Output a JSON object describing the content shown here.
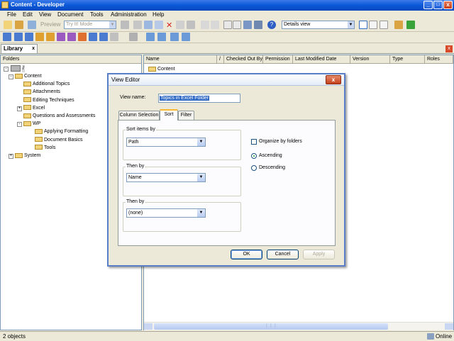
{
  "window": {
    "title": "Content - Developer",
    "min_glyph": "_",
    "max_glyph": "□",
    "close_glyph": "x"
  },
  "menu": [
    "File",
    "Edit",
    "View",
    "Document",
    "Tools",
    "Administration",
    "Help"
  ],
  "toolbar": {
    "preview_label": "Preview",
    "mode_combo": "Try It! Mode",
    "view_combo": "Details view"
  },
  "library_tab": {
    "label": "Library",
    "close_glyph": "x"
  },
  "folders": {
    "header": "Folders",
    "root": "/",
    "items": [
      {
        "label": "Content",
        "level": 1,
        "expander": "-"
      },
      {
        "label": "Additional Topics",
        "level": 2,
        "expander": ""
      },
      {
        "label": "Attachments",
        "level": 2,
        "expander": ""
      },
      {
        "label": "Editing Techniques",
        "level": 2,
        "expander": ""
      },
      {
        "label": "Excel",
        "level": 2,
        "expander": "+"
      },
      {
        "label": "Questions and Assessments",
        "level": 2,
        "expander": ""
      },
      {
        "label": "WP",
        "level": 2,
        "expander": "-"
      },
      {
        "label": "Applying Formatting",
        "level": 3,
        "expander": ""
      },
      {
        "label": "Document Basics",
        "level": 3,
        "expander": ""
      },
      {
        "label": "Tools",
        "level": 3,
        "expander": ""
      },
      {
        "label": "System",
        "level": 1,
        "expander": "+"
      }
    ]
  },
  "list": {
    "columns": [
      "Name",
      "/",
      "Checked Out By",
      "Permission",
      "Last Modified Date",
      "Version",
      "Type",
      "Roles"
    ],
    "rows": [
      "Content"
    ],
    "scroll_glyph": "⋮⋮⋮"
  },
  "status": {
    "count": "2 objects",
    "connection": "Online"
  },
  "dialog": {
    "title": "View Editor",
    "close_glyph": "x",
    "view_name_label": "View name:",
    "view_name_value": "Topics in Excel Folder",
    "tabs": [
      "Column Selection",
      "Sort",
      "Filter"
    ],
    "active_tab": "Sort",
    "sort_items_by_label": "Sort items by",
    "sort_items_by_value": "Path",
    "then_by_1_label": "Then by",
    "then_by_1_value": "Name",
    "then_by_2_label": "Then by",
    "then_by_2_value": "(none)",
    "organize_by_folders": "Organize by folders",
    "organize_checked": false,
    "ascending": "Ascending",
    "descending": "Descending",
    "sort_direction": "Ascending",
    "ok": "OK",
    "cancel": "Cancel",
    "apply": "Apply",
    "dropdown_glyph": "▼"
  },
  "colors": {
    "titlebar": "#0a58d8",
    "folder": "#f3d37a",
    "selection": "#316ac5",
    "tab_highlight": "#f9b934"
  }
}
